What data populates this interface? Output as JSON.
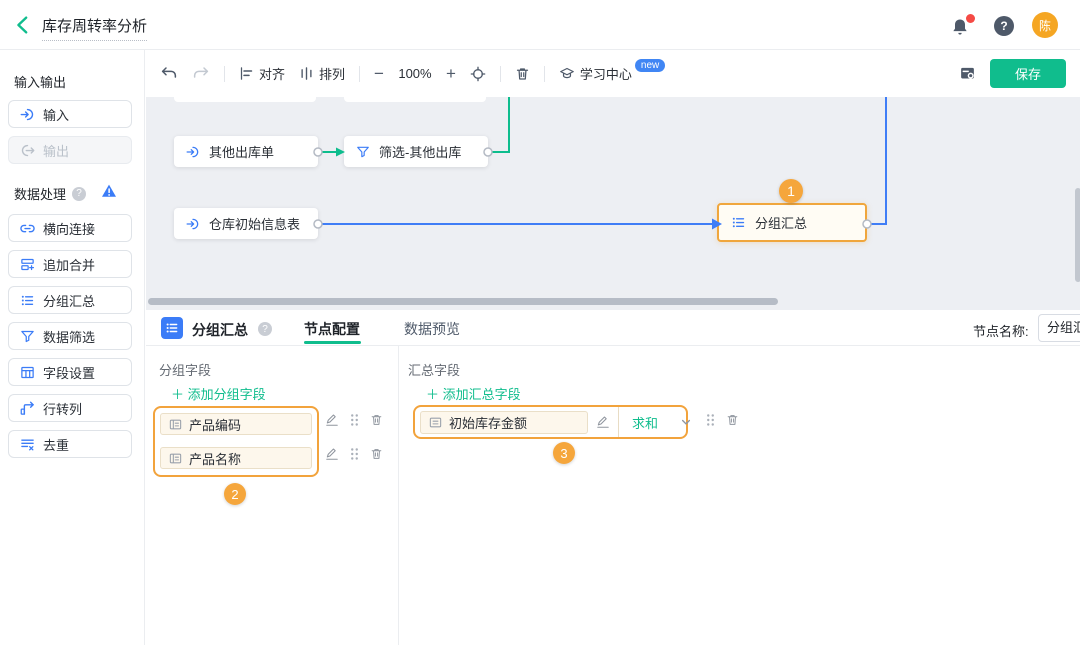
{
  "topbar": {
    "title": "库存周转率分析",
    "avatar": "陈"
  },
  "toolbar": {
    "align": "对齐",
    "arrange": "排列",
    "minus": "−",
    "zoom_value": "100%",
    "plus": "+",
    "learning_center": "学习中心",
    "new_badge": "new",
    "save": "保存"
  },
  "sidebar": {
    "io_section": "输入输出",
    "input": "输入",
    "output": "输出",
    "process_section": "数据处理",
    "tools": [
      "横向连接",
      "追加合并",
      "分组汇总",
      "数据筛选",
      "字段设置",
      "行转列",
      "去重"
    ]
  },
  "canvas": {
    "node_other_out": "其他出库单",
    "node_filter": "筛选-其他出库",
    "node_warehouse": "仓库初始信息表",
    "node_group": "分组汇总",
    "badge_1": "1"
  },
  "panel": {
    "title": "分组汇总",
    "tab_config": "节点配置",
    "tab_preview": "数据预览",
    "node_name_label": "节点名称:",
    "node_name_value": "分组汇总",
    "group": {
      "label": "分组字段",
      "add": "＋ 添加分组字段",
      "fields": [
        "产品编码",
        "产品名称"
      ],
      "badge": "2"
    },
    "summary": {
      "label": "汇总字段",
      "add": "＋ 添加汇总字段",
      "field": "初始库存金额",
      "agg": "求和",
      "badge": "3"
    }
  },
  "icons": {
    "help": "?",
    "warning": "!"
  },
  "colors": {
    "accent_green": "#10bd8d",
    "primary_blue": "#3b7cf7",
    "highlight_orange": "#f2a33c",
    "avatar_orange": "#f5a623",
    "teal_link": "#0dbd8d"
  }
}
